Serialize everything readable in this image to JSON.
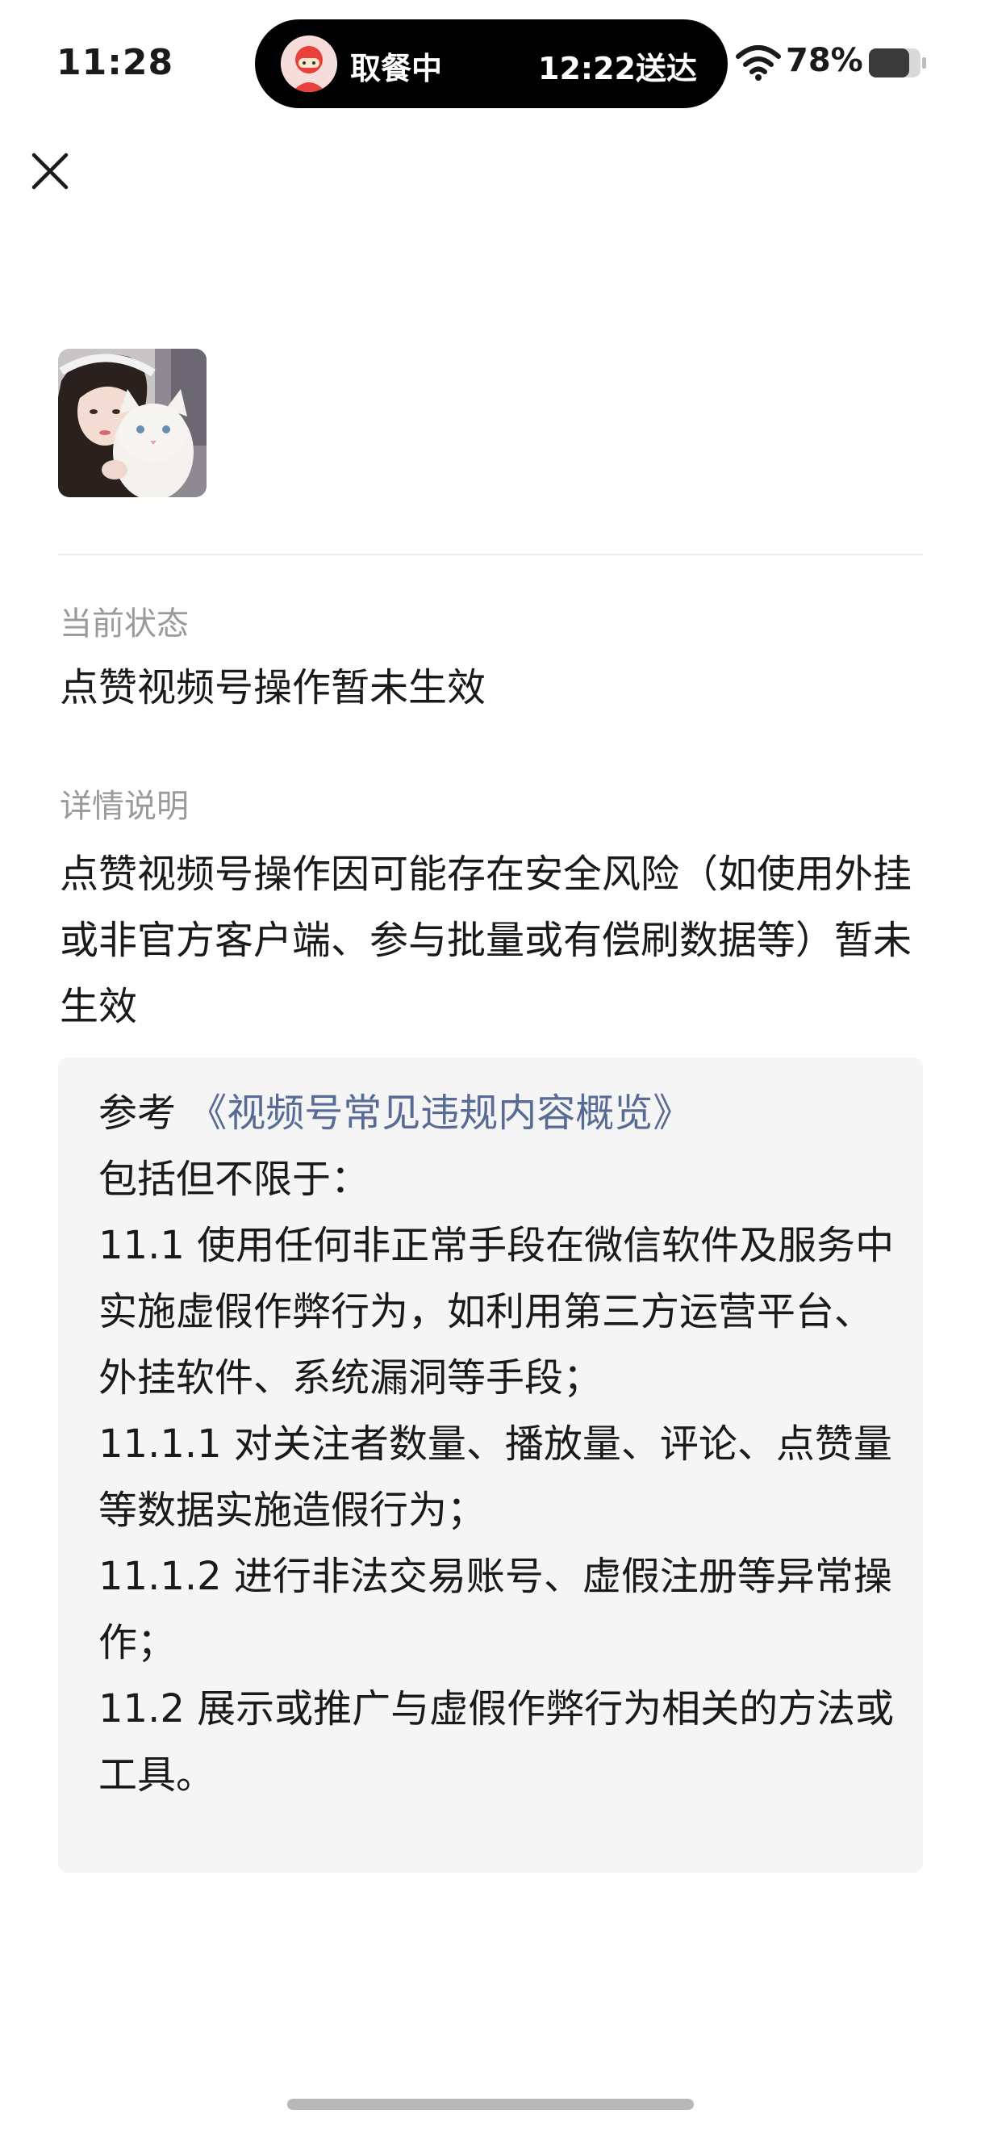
{
  "status_bar": {
    "time": "11:28",
    "live_activity": {
      "status": "取餐中",
      "eta": "12:22送达"
    },
    "battery_percent": "78%"
  },
  "profile": {
    "avatar": "user-avatar-photo"
  },
  "current_status": {
    "label": "当前状态",
    "value": "点赞视频号操作暂未生效"
  },
  "details": {
    "label": "详情说明",
    "text": "点赞视频号操作因可能存在安全风险（如使用外挂或非官方客户端、参与批量或有偿刷数据等）暂未生效"
  },
  "reference": {
    "prefix": "参考 ",
    "link_text": "《视频号常见违规内容概览》",
    "intro": "包括但不限于：",
    "items": [
      "11.1 使用任何非正常手段在微信软件及服务中实施虚假作弊行为，如利用第三方运营平台、外挂软件、系统漏洞等手段；",
      "11.1.1 对关注者数量、播放量、评论、点赞量等数据实施造假行为；",
      "11.1.2 进行非法交易账号、虚假注册等异常操作；",
      "11.2 展示或推广与虚假作弊行为相关的方法或工具。"
    ]
  },
  "icons": {
    "close": "close-icon",
    "wifi": "wifi-icon",
    "battery": "battery-icon"
  },
  "colors": {
    "link": "#576b95",
    "label": "#9a9a9a",
    "ref_background": "#f5f5f5"
  }
}
